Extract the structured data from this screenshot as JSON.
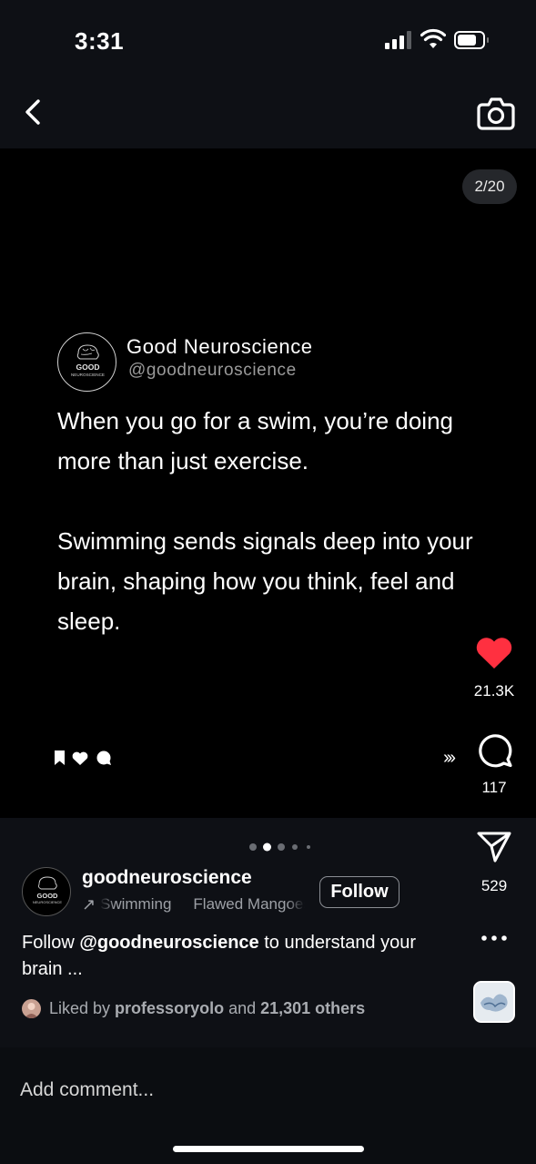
{
  "status_bar": {
    "time": "3:31",
    "signal_icon": "cellular-signal-icon",
    "wifi_icon": "wifi-icon",
    "battery_icon": "battery-icon"
  },
  "nav": {
    "back_icon": "chevron-left-icon",
    "camera_icon": "camera-icon"
  },
  "post": {
    "page_counter": "2/20",
    "carousel_dots_count": 5,
    "carousel_active_index": 1,
    "card": {
      "brand_name": "Good Neuroscience",
      "brand_handle": "@goodneuroscience",
      "logo_text_top": "GOOD",
      "logo_text_bottom": "NEUROSCIENCE",
      "paragraph_1": "When you go for a swim, you’re doing more than just exercise.",
      "paragraph_2": "Swimming sends signals deep into your brain, shaping how you think, feel and sleep."
    },
    "mini_icons": [
      "bookmark-icon",
      "heart-icon",
      "comment-icon"
    ]
  },
  "actions": {
    "like_count": "21.3K",
    "comment_count": "117",
    "share_count": "529",
    "carousel_arrows": "›››",
    "like_color": "#ff3040"
  },
  "author": {
    "username": "goodneuroscience",
    "audio_arrow": "↗",
    "audio_items": [
      "Swimming",
      "Flawed Mangoes"
    ],
    "follow_label": "Follow"
  },
  "caption": {
    "pre": "Follow ",
    "mention": "@goodneuroscience",
    "post": " to understand your brain ..."
  },
  "likes": {
    "prefix": "Liked by ",
    "user": "professoryolo",
    "middle": " and ",
    "others": "21,301 others"
  },
  "comment": {
    "placeholder": "Add comment..."
  }
}
